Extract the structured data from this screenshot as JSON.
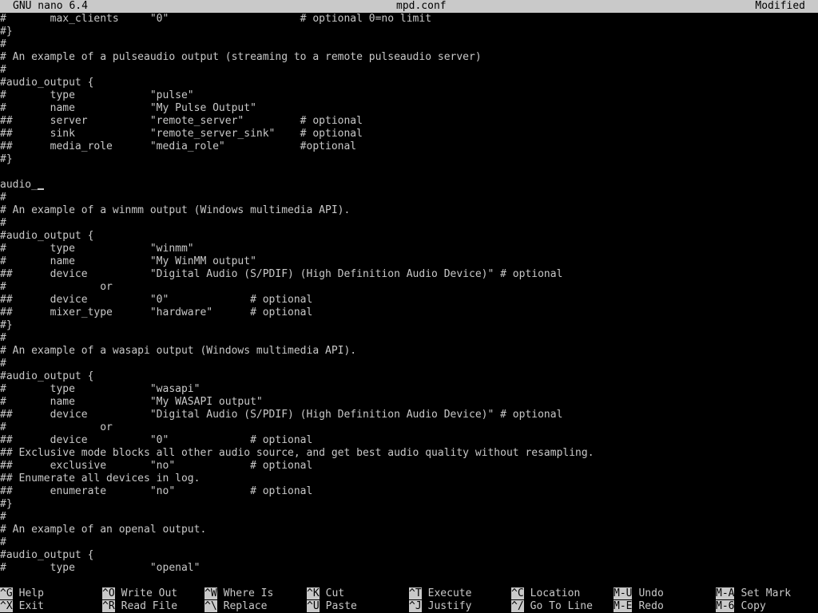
{
  "title_bar": {
    "app": "GNU nano 6.4",
    "filename": "mpd.conf",
    "status": "Modified"
  },
  "editor": {
    "lines": [
      "#       max_clients     \"0\"                     # optional 0=no limit",
      "#}",
      "#",
      "# An example of a pulseaudio output (streaming to a remote pulseaudio server)",
      "#",
      "#audio_output {",
      "#       type            \"pulse\"",
      "#       name            \"My Pulse Output\"",
      "##      server          \"remote_server\"         # optional",
      "##      sink            \"remote_server_sink\"    # optional",
      "##      media_role      \"media_role\"            #optional",
      "#}",
      "",
      "audio_",
      "#",
      "# An example of a winmm output (Windows multimedia API).",
      "#",
      "#audio_output {",
      "#       type            \"winmm\"",
      "#       name            \"My WinMM output\"",
      "##      device          \"Digital Audio (S/PDIF) (High Definition Audio Device)\" # optional",
      "#               or",
      "##      device          \"0\"             # optional",
      "##      mixer_type      \"hardware\"      # optional",
      "#}",
      "#",
      "# An example of a wasapi output (Windows multimedia API).",
      "#",
      "#audio_output {",
      "#       type            \"wasapi\"",
      "#       name            \"My WASAPI output\"",
      "##      device          \"Digital Audio (S/PDIF) (High Definition Audio Device)\" # optional",
      "#               or",
      "##      device          \"0\"             # optional",
      "## Exclusive mode blocks all other audio source, and get best audio quality without resampling.",
      "##      exclusive       \"no\"            # optional",
      "## Enumerate all devices in log.",
      "##      enumerate       \"no\"            # optional",
      "#}",
      "#",
      "# An example of an openal output.",
      "#",
      "#audio_output {",
      "#       type            \"openal\""
    ]
  },
  "shortcuts": [
    {
      "key": "^G",
      "label": "Help"
    },
    {
      "key": "^O",
      "label": "Write Out"
    },
    {
      "key": "^W",
      "label": "Where Is"
    },
    {
      "key": "^K",
      "label": "Cut"
    },
    {
      "key": "^T",
      "label": "Execute"
    },
    {
      "key": "^C",
      "label": "Location"
    },
    {
      "key": "M-U",
      "label": "Undo"
    },
    {
      "key": "M-A",
      "label": "Set Mark"
    },
    {
      "key": "^X",
      "label": "Exit"
    },
    {
      "key": "^R",
      "label": "Read File"
    },
    {
      "key": "^\\",
      "label": "Replace"
    },
    {
      "key": "^U",
      "label": "Paste"
    },
    {
      "key": "^J",
      "label": "Justify"
    },
    {
      "key": "^/",
      "label": "Go To Line"
    },
    {
      "key": "M-E",
      "label": "Redo"
    },
    {
      "key": "M-6",
      "label": "Copy"
    }
  ]
}
